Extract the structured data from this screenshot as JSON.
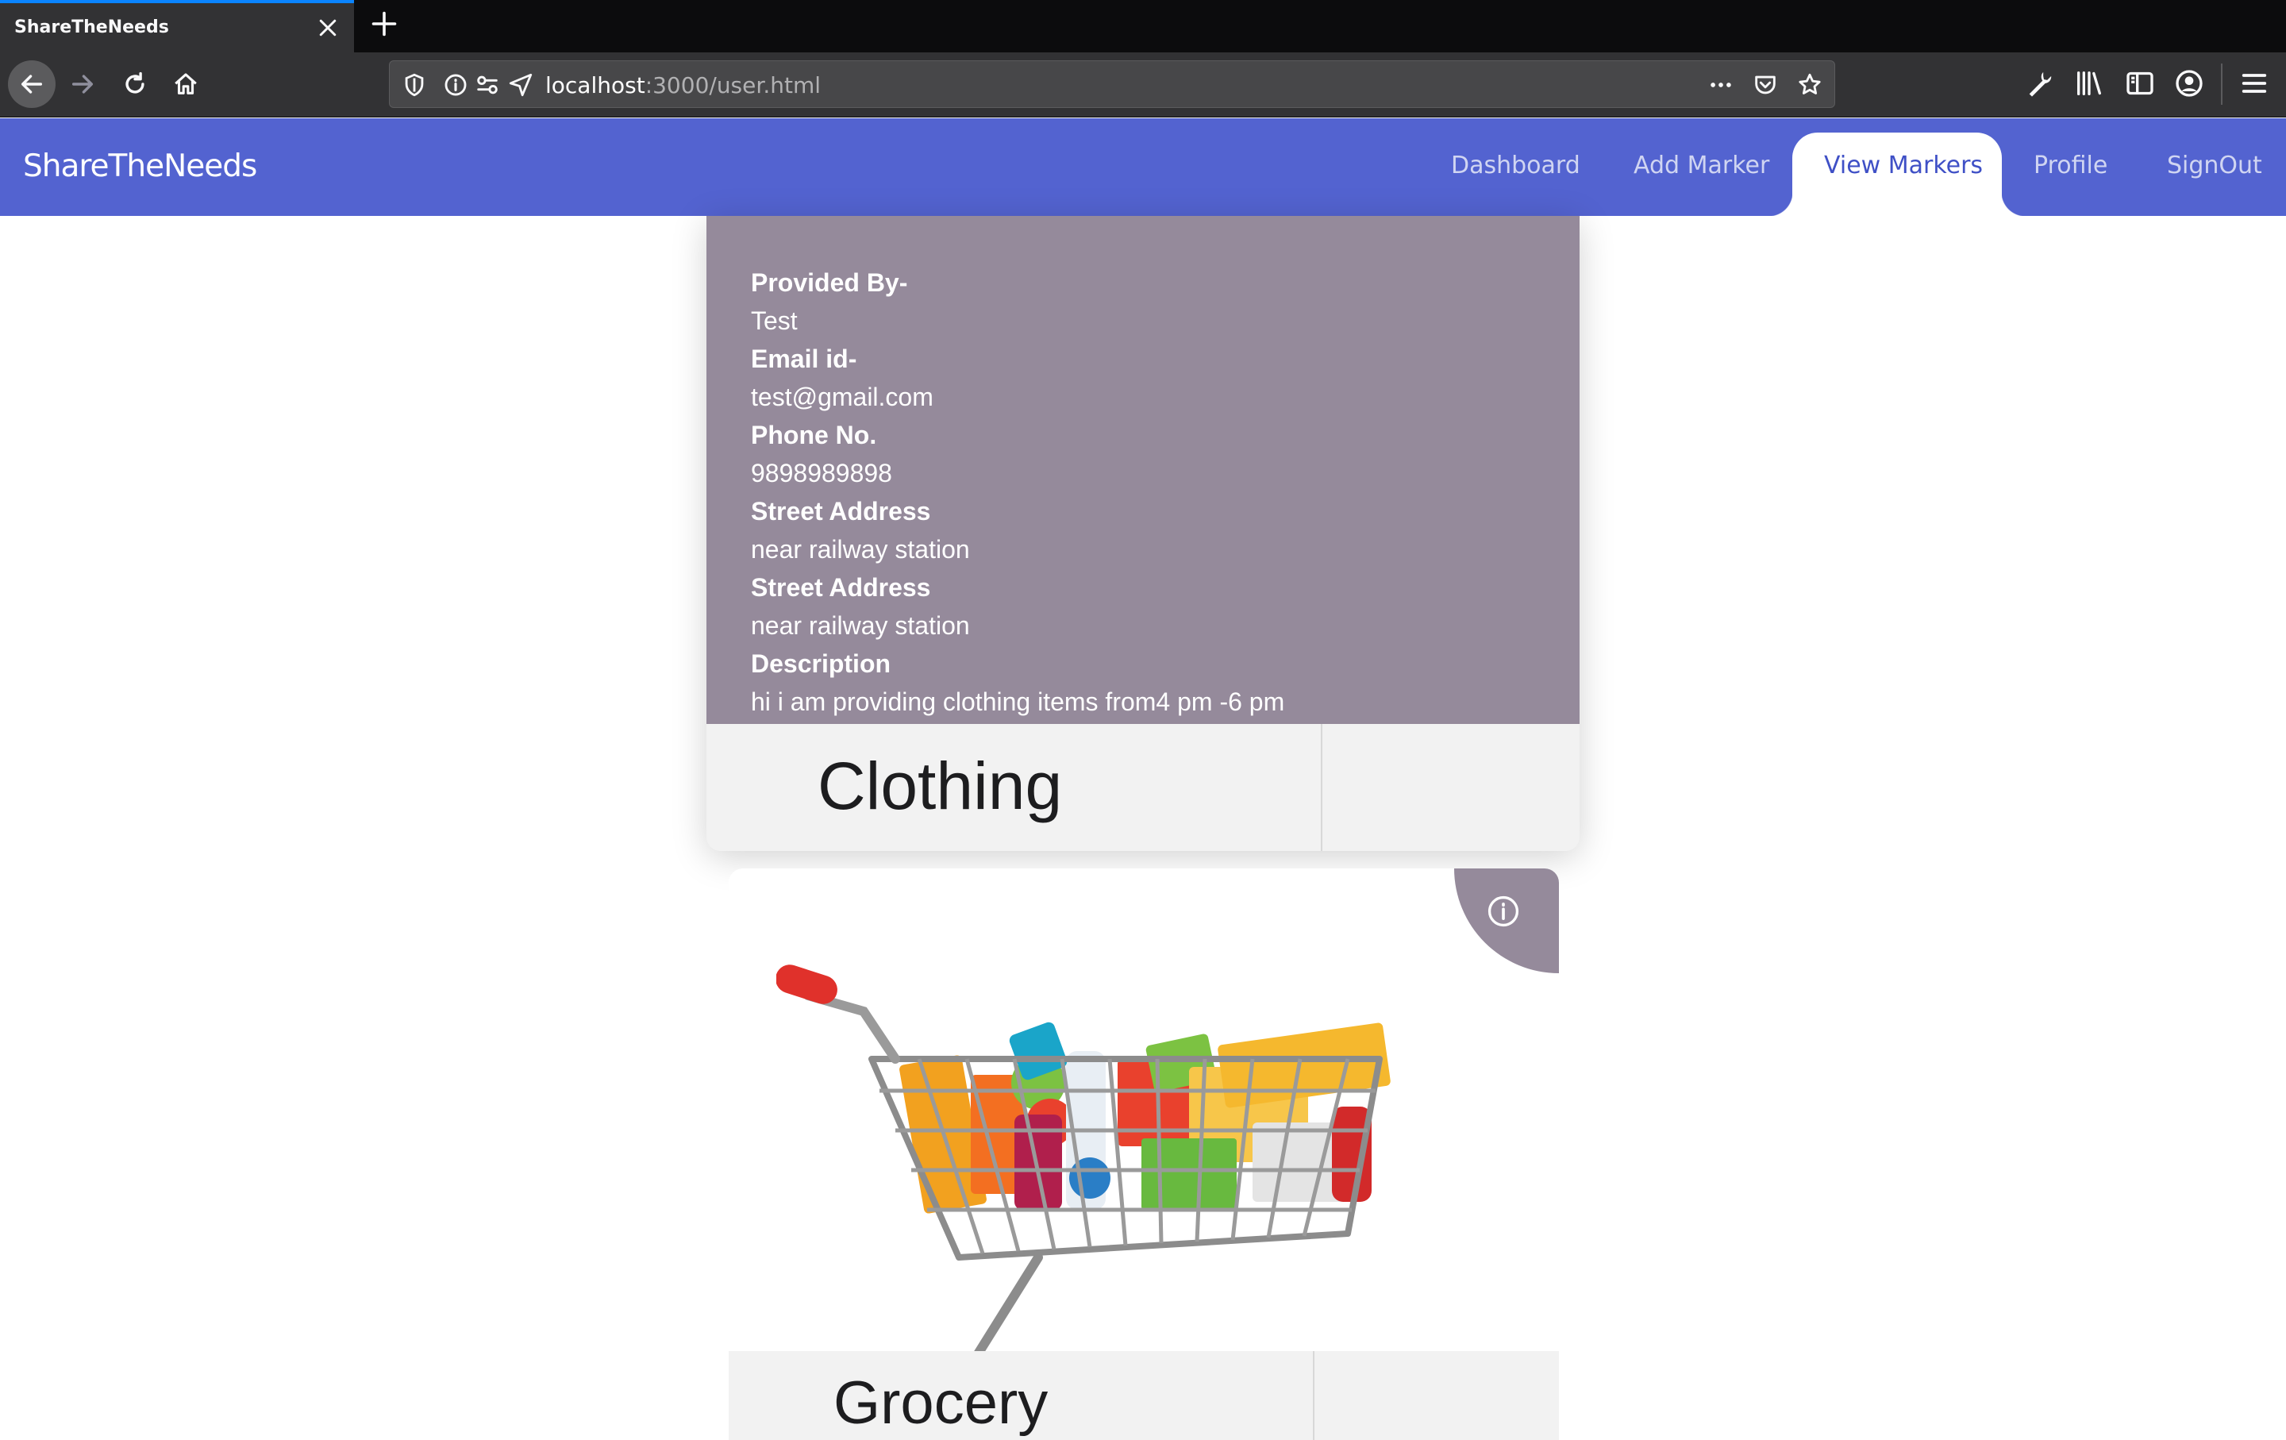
{
  "browser": {
    "tab_title": "ShareTheNeeds",
    "url_host": "localhost",
    "url_path": ":3000/user.html"
  },
  "app": {
    "brand": "ShareTheNeeds",
    "menu": {
      "dashboard": "Dashboard",
      "add_marker": "Add Marker",
      "view_markers": "View Markers",
      "profile": "Profile",
      "signout": "SignOut"
    },
    "accent_color": "#5363d0",
    "card_info_color": "#958a9b"
  },
  "cards": [
    {
      "category": "Clothing",
      "details": {
        "provided_by_label": "Provided By-",
        "provided_by": "Test",
        "email_label": "Email id-",
        "email": "test@gmail.com",
        "phone_label": "Phone No.",
        "phone": "9898989898",
        "street_label_1": "Street Address",
        "street_1": "near railway station",
        "street_label_2": "Street Address",
        "street_2": "near railway station",
        "description_label": "Description",
        "description": "hi i am providing clothing items from4 pm -6 pm"
      }
    },
    {
      "category": "Grocery",
      "image_icon": "shopping-cart-image"
    }
  ]
}
